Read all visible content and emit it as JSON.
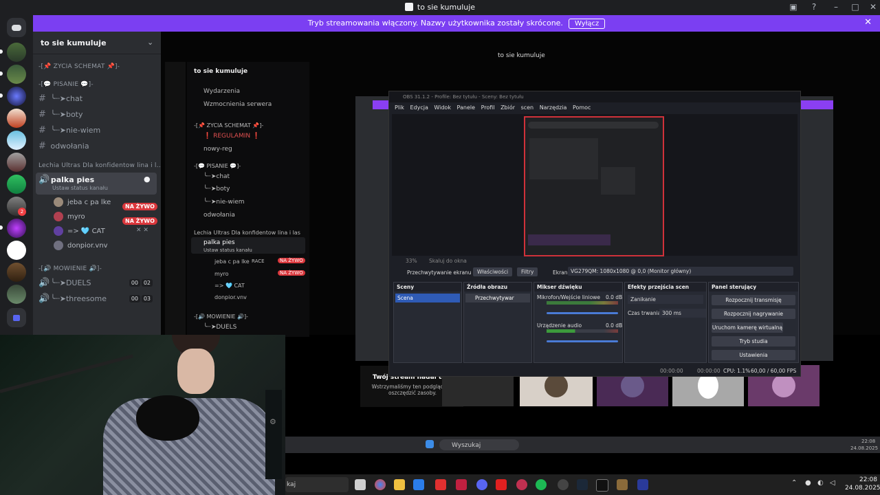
{
  "titlebar": {
    "title": "to sie kumuluje"
  },
  "banner": {
    "text": "Tryb streamowania włączony. Nazwy użytkownika zostały skrócone.",
    "button": "Wyłącz"
  },
  "server": {
    "name": "to sie kumuluje"
  },
  "channels": {
    "cat1": "-[📌 ZYCIA SCHEMAT 📌]-",
    "cat2": "-[💬 PISANIE 💬]-",
    "text_channels": [
      "╰┈➤chat",
      "╰┈➤boty",
      "╰┈➤nie-wiem",
      "odwołania"
    ],
    "voice_cat": "Lechia Ultras Dla konfidentow lina i l...",
    "voice_channel": "palka pies",
    "voice_status": "Ustaw status kanału",
    "users": [
      {
        "name": "jeba c pa lke",
        "live": "NA ŻYWO"
      },
      {
        "name": "myro",
        "live": "NA ŻYWO"
      },
      {
        "name": "=> 🩵 CAT",
        "live": ""
      },
      {
        "name": "donpior.vnv",
        "live": ""
      }
    ],
    "cat3": "-[🔊 MOWIENIE 🔊]-",
    "voice_channels2": [
      {
        "name": "╰┈➤DUELS",
        "count_a": "00",
        "count_b": "02"
      },
      {
        "name": "╰┈➤threesome",
        "count_a": "00",
        "count_b": "03"
      }
    ]
  },
  "capture_discord": {
    "title": "to sie kumuluje",
    "server": "to sie kumuluje",
    "items": [
      "Wydarzenia",
      "Wzmocnienia serwera",
      "-[📌 ZYCIA SCHEMAT 📌]-",
      "❗ REGULAMIN ❗",
      "nowy-reg",
      "-[💬 PISANIE 💬]-",
      "╰┈➤chat",
      "╰┈➤boty",
      "╰┈➤nie-wiem",
      "odwołania",
      "Lechia Ultras Dla konfidentow lina i las",
      "palka pies",
      "Ustaw status kanału",
      "jeba c pa lke",
      "myro",
      "=> 🩵 CAT",
      "donpior.vnv",
      "-[🔊 MOWIENIE 🔊]-",
      "╰┈➤DUELS"
    ],
    "live": "NA ŻYWO",
    "race": "RACE",
    "stream_msg_title": "Twój stream nadal trwa!",
    "stream_msg_body": "Wstrzymaliśmy ten podgląd, by oszczędzić zasoby."
  },
  "obs": {
    "title": "OBS 31.1.2 - Profile: Bez tytułu - Sceny: Bez tytułu",
    "menu": [
      "Plik",
      "Edycja",
      "Widok",
      "Panele",
      "Profil",
      "Zbiór scen",
      "Narzędzia",
      "Pomoc"
    ],
    "zoom": "33%",
    "fit": "Skaluj do okna",
    "source_bar": {
      "source": "Przechwytywanie ekranu",
      "props": "Właściwości",
      "filters": "Filtry",
      "screen_label": "Ekran",
      "screen_value": "VG279QM: 1080x1080 @ 0,0 (Monitor główny)"
    },
    "docks": {
      "scenes": {
        "title": "Sceny",
        "items": [
          "Scena"
        ]
      },
      "sources": {
        "title": "Źródła obrazu",
        "items": [
          "Przechwytywar"
        ]
      },
      "mixer": {
        "title": "Mikser dźwięku",
        "tracks": [
          {
            "name": "Mikrofon/Wejście liniowe",
            "db": "0.0 dB"
          },
          {
            "name": "Urządzenie audio",
            "db": "0.0 dB"
          }
        ]
      },
      "transitions": {
        "title": "Efekty przejścia scen",
        "type": "Zanikanie",
        "duration_label": "Czas trwania",
        "duration": "300 ms"
      },
      "controls": {
        "title": "Panel sterujący",
        "buttons": [
          "Rozpocznij transmisję",
          "Rozpocznij nagrywanie",
          "Uruchom kamerę wirtualną",
          "Tryb studia",
          "Ustawienia"
        ]
      }
    },
    "status": {
      "t1": "00:00:00",
      "t2": "00:00:00",
      "cpu": "CPU: 1.1%",
      "fps": "60,00 / 60,00 FPS"
    }
  },
  "taskbar2": {
    "search": "Wyszukaj",
    "time": "22:08",
    "date": "24.08.2025"
  },
  "taskbar": {
    "search": "kaj",
    "time": "22:08",
    "date": "24.08.2025"
  }
}
